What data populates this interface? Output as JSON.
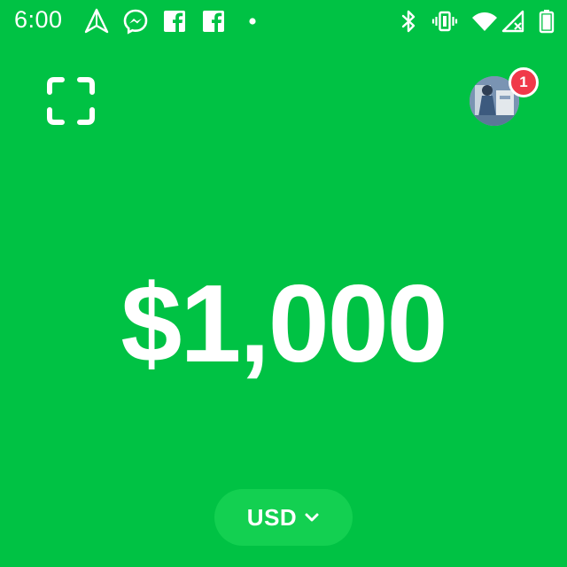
{
  "status_bar": {
    "time": "6:00",
    "left_icons": [
      "send-arrow-icon",
      "messenger-icon",
      "facebook-icon",
      "facebook-icon",
      "notification-dot-icon"
    ],
    "right_icons": [
      "bluetooth-icon",
      "vibrate-icon",
      "wifi-icon",
      "no-signal-icon",
      "battery-icon"
    ]
  },
  "header": {
    "scan_icon": "scan-qr-icon",
    "notification_count": "1"
  },
  "main": {
    "balance": "$1,000"
  },
  "currency": {
    "label": "USD",
    "icon": "chevron-down-icon"
  },
  "colors": {
    "background": "#00c244",
    "button": "#13d051",
    "badge": "#f0394a",
    "text": "#ffffff"
  }
}
